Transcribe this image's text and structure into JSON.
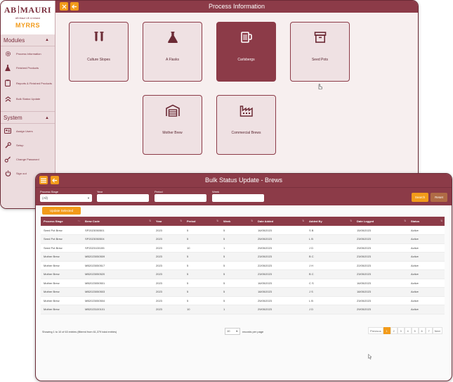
{
  "process_window": {
    "title": "Process Information",
    "brand": {
      "logo_left": "AB",
      "logo_right": "MAURI",
      "logo_sub": "AB Mauri UK & Ireland",
      "app_name": "MYRRS"
    },
    "modules_header": "Modules",
    "modules": [
      {
        "label": "Process Information",
        "icon": "gear-icon"
      },
      {
        "label": "Finished Products",
        "icon": "flask-icon"
      },
      {
        "label": "Reports & Finished Products",
        "icon": "clipboard-icon"
      },
      {
        "label": "Bulk Status Update",
        "icon": "chevrons-up-icon"
      }
    ],
    "system_header": "System",
    "system": [
      {
        "label": "Assign Users",
        "icon": "id-card-icon"
      },
      {
        "label": "Setup",
        "icon": "wrench-icon"
      },
      {
        "label": "Change Password",
        "icon": "key-icon"
      },
      {
        "label": "Sign out",
        "icon": "power-icon"
      }
    ],
    "tiles": [
      {
        "label": "Culture Slopes",
        "icon": "test-tubes-icon",
        "active": false
      },
      {
        "label": "A Flasks",
        "icon": "flask-icon",
        "active": false
      },
      {
        "label": "Carlsbergs",
        "icon": "mug-icon",
        "active": true
      },
      {
        "label": "Seed Pots",
        "icon": "archive-box-icon",
        "active": false
      },
      {
        "label": "Mother Brew",
        "icon": "warehouse-icon",
        "active": false
      },
      {
        "label": "Commercial Brews",
        "icon": "factory-icon",
        "active": false
      }
    ]
  },
  "bulk_window": {
    "title": "Bulk Status Update - Brews",
    "filters": {
      "process_stage_label": "Process Stage",
      "process_stage_value": "(All)",
      "year_label": "Year",
      "period_label": "Period",
      "week_label": "Week"
    },
    "search_label": "Search",
    "reset_label": "Reset",
    "update_selected_label": "Update Selected",
    "columns": [
      "Process Stage",
      "Brew Code",
      "Year",
      "Period",
      "Week",
      "Date Added",
      "Added By",
      "Date Logged",
      "Status"
    ],
    "rows": [
      [
        "Seed Pot Brew",
        "SP2023050501",
        "2023",
        "5",
        "5",
        "16/05/2023",
        "S B",
        "15/05/2023",
        "Active"
      ],
      [
        "Seed Pot Brew",
        "SP2023050504",
        "2023",
        "5",
        "5",
        "25/05/2023",
        "L B",
        "23/05/2023",
        "Active"
      ],
      [
        "Seed Pot Brew",
        "SP2023100155",
        "2023",
        "10",
        "1",
        "29/05/2023",
        "J D",
        "29/05/2023",
        "Active"
      ],
      [
        "Mother Brew",
        "MB2023050509",
        "2023",
        "5",
        "5",
        "23/05/2023",
        "B C",
        "23/05/2023",
        "Active"
      ],
      [
        "Mother Brew",
        "MB2023050517",
        "2023",
        "5",
        "5",
        "22/05/2023",
        "J H",
        "22/05/2023",
        "Active"
      ],
      [
        "Mother Brew",
        "MB2023050520",
        "2023",
        "5",
        "5",
        "23/05/2023",
        "B C",
        "23/05/2023",
        "Active"
      ],
      [
        "Mother Brew",
        "MB2023050501",
        "2023",
        "5",
        "5",
        "16/05/2023",
        "C S",
        "16/05/2023",
        "Active"
      ],
      [
        "Mother Brew",
        "MB2023050503",
        "2023",
        "5",
        "5",
        "18/05/2023",
        "J S",
        "18/05/2023",
        "Active"
      ],
      [
        "Mother Brew",
        "MB2023050504",
        "2023",
        "5",
        "5",
        "25/05/2023",
        "L B",
        "23/05/2023",
        "Active"
      ],
      [
        "Mother Brew",
        "MB2023100101",
        "2023",
        "10",
        "1",
        "29/05/2023",
        "J D",
        "29/05/2023",
        "Active"
      ]
    ],
    "entries_text": "Showing 1 to 10 of 63 entries (filtered from 61,379 total entries)",
    "per_page_value": "10",
    "per_page_label": "records per page",
    "pagination": [
      "Previous",
      "1",
      "2",
      "3",
      "4",
      "5",
      "6",
      "7",
      "Next"
    ],
    "current_page": "1"
  },
  "colors": {
    "brand": "#8c3b48",
    "accent": "#f29b1a",
    "tile_bg": "#efe1e3",
    "sidebar_bg": "#ecdcde"
  }
}
